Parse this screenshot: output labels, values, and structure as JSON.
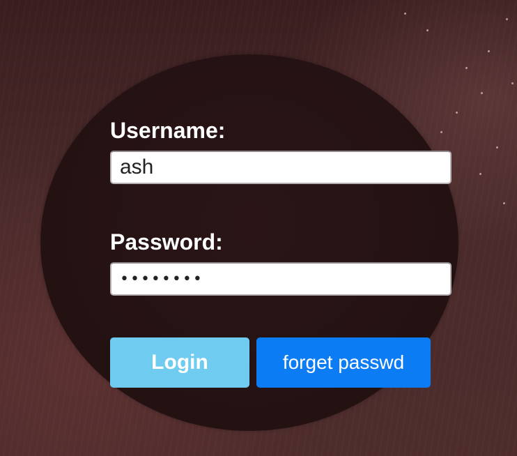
{
  "login_form": {
    "username_label": "Username:",
    "username_value": "ash",
    "password_label": "Password:",
    "password_value": "********",
    "login_button": "Login",
    "forget_button": "forget passwd"
  },
  "colors": {
    "background": "#4a2a2b",
    "circle": "#241213",
    "login_button": "#6fcbf0",
    "forget_button": "#0c7cf5",
    "label_text": "#ffffff"
  }
}
